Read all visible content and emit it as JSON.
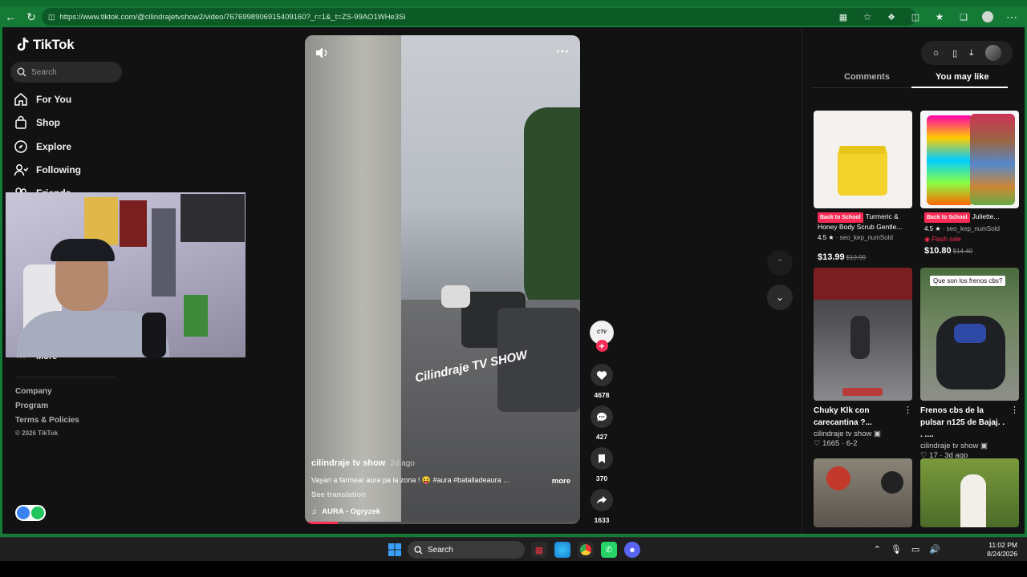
{
  "browser": {
    "url": "https://www.tiktok.com/@cilindrajetvshow2/video/7676998906915409160?_r=1&_t=ZS-99AO1WHe3Si"
  },
  "sidebar": {
    "logo": "TikTok",
    "search_placeholder": "Search",
    "items": [
      {
        "label": "For You",
        "icon": "home-icon"
      },
      {
        "label": "Shop",
        "icon": "shopping-bag-icon"
      },
      {
        "label": "Explore",
        "icon": "compass-icon"
      },
      {
        "label": "Following",
        "icon": "following-icon"
      },
      {
        "label": "Friends",
        "icon": "friends-icon"
      }
    ],
    "more_label": "More",
    "footer": [
      "Company",
      "Program",
      "Terms & Policies"
    ],
    "copyright": "© 2026 TikTok"
  },
  "video": {
    "author": "cilindraje tv show",
    "age": "2d ago",
    "description": "Vayan a farmear aura pa la zona ! 😝 #aura #batalladeaura ...",
    "more_label": "more",
    "see_translation": "See translation",
    "music": "AURA - Ogryzek",
    "watermark": "Cilindraje TV SHOW",
    "progress": 0.12
  },
  "actions": {
    "likes": "4678",
    "comments": "427",
    "saves": "370",
    "shares": "1633"
  },
  "right_panel": {
    "tabs": [
      "Comments",
      "You may like"
    ],
    "active_tab": "You may like",
    "products": [
      {
        "badge": "Back to School",
        "title": "Turmeric & Honey Body Scrub Gentle...",
        "rating": "4.5",
        "sold": "seo_kep_numSold",
        "price": "$13.99",
        "old_price": "$19.99",
        "flash": ""
      },
      {
        "badge": "Back to School",
        "title": "Juliette...",
        "rating": "4.5",
        "sold": "seo_kep_numSold",
        "price": "$10.80",
        "old_price": "$14.40",
        "flash": "Flash sale"
      }
    ],
    "videos": [
      {
        "title": "Chuky Klk con carecantina ?...",
        "author": "cilindraje tv show",
        "likes": "1665",
        "age": "6-2",
        "overlay": ""
      },
      {
        "title": "Frenos cbs de la pulsar n125 de Bajaj. . . ....",
        "author": "cilindraje tv show",
        "likes": "17",
        "age": "3d ago",
        "overlay": "Que son los frenos cbs?"
      }
    ]
  },
  "taskbar": {
    "search_label": "Search",
    "time": "11:02 PM",
    "date": "8/24/2026"
  },
  "colors": {
    "browser_frame": "#157a36",
    "accent": "#fe2c55",
    "background": "#121212"
  }
}
